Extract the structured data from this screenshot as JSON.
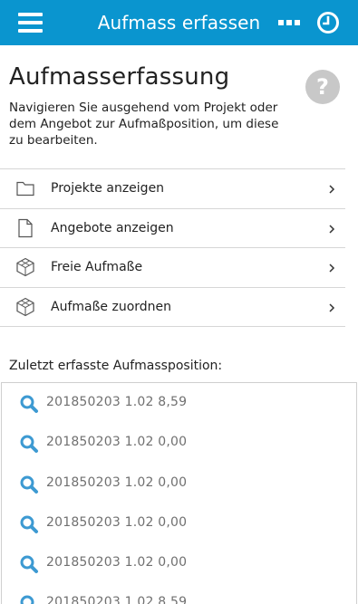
{
  "app": {
    "title": "Aufmass erfassen"
  },
  "page": {
    "heading": "Aufmasserfassung",
    "intro": "Navigieren Sie ausgehend vom Projekt oder dem Angebot zur Aufmaßposition, um diese zu bearbeiten."
  },
  "menu": {
    "items": [
      {
        "label": "Projekte anzeigen",
        "icon": "folder-icon"
      },
      {
        "label": "Angebote anzeigen",
        "icon": "document-icon"
      },
      {
        "label": "Freie Aufmaße",
        "icon": "cube-icon"
      },
      {
        "label": "Aufmaße zuordnen",
        "icon": "cube-icon"
      }
    ]
  },
  "recent": {
    "title": "Zuletzt erfasste Aufmassposition:",
    "items": [
      {
        "text": "201850203 1.02 8,59"
      },
      {
        "text": "201850203 1.02 0,00"
      },
      {
        "text": "201850203 1.02 0,00"
      },
      {
        "text": "201850203 1.02 0,00"
      },
      {
        "text": "201850203 1.02 0,00"
      },
      {
        "text": "201850203 1.02 8,59"
      }
    ]
  },
  "colors": {
    "header": "#0a95cf",
    "search_icon": "#3d9ad2",
    "help_icon": "#c8c8c8"
  }
}
